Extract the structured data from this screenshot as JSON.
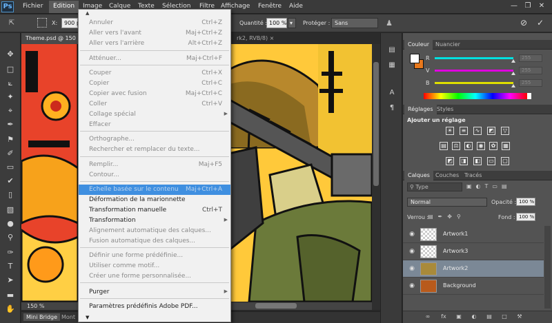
{
  "app": {
    "logo": "Ps"
  },
  "menubar": {
    "items": [
      "Fichier",
      "Edition",
      "Image",
      "Calque",
      "Texte",
      "Sélection",
      "Filtre",
      "Affichage",
      "Fenêtre",
      "Aide"
    ],
    "active_item": "Edition"
  },
  "options_bar": {
    "x_label": "X:",
    "x_value": "900 px",
    "quantity_label": "Quantité :",
    "quantity_value": "100 %",
    "protect_label": "Protéger :",
    "protect_value": "Sans"
  },
  "document": {
    "tab_title": "Theme.psd @ 150",
    "tab2_title": "rk2, RVB/8) ×",
    "zoom": "150 %"
  },
  "bottom_tabs": [
    "Mini Bridge",
    "Mont"
  ],
  "edit_menu": {
    "items": [
      {
        "label": "Annuler",
        "shortcut": "Ctrl+Z",
        "enabled": false
      },
      {
        "label": "Aller vers l'avant",
        "shortcut": "Maj+Ctrl+Z",
        "enabled": false
      },
      {
        "label": "Aller vers l'arrière",
        "shortcut": "Alt+Ctrl+Z",
        "enabled": false
      },
      {
        "label": "Atténuer...",
        "shortcut": "Maj+Ctrl+F",
        "enabled": false
      },
      {
        "label": "Couper",
        "shortcut": "Ctrl+X",
        "enabled": false
      },
      {
        "label": "Copier",
        "shortcut": "Ctrl+C",
        "enabled": false
      },
      {
        "label": "Copier avec fusion",
        "shortcut": "Maj+Ctrl+C",
        "enabled": false
      },
      {
        "label": "Coller",
        "shortcut": "Ctrl+V",
        "enabled": false
      },
      {
        "label": "Collage spécial",
        "shortcut": "",
        "enabled": false,
        "submenu": true
      },
      {
        "label": "Effacer",
        "shortcut": "",
        "enabled": false
      },
      {
        "label": "Orthographe...",
        "shortcut": "",
        "enabled": false
      },
      {
        "label": "Rechercher et remplacer du texte...",
        "shortcut": "",
        "enabled": false
      },
      {
        "label": "Remplir...",
        "shortcut": "Maj+F5",
        "enabled": false
      },
      {
        "label": "Contour...",
        "shortcut": "",
        "enabled": false
      },
      {
        "label": "Echelle basée sur le contenu",
        "shortcut": "Maj+Ctrl+A",
        "enabled": false,
        "highlighted": true
      },
      {
        "label": "Déformation de la marionnette",
        "shortcut": "",
        "enabled": true
      },
      {
        "label": "Transformation manuelle",
        "shortcut": "Ctrl+T",
        "enabled": true
      },
      {
        "label": "Transformation",
        "shortcut": "",
        "enabled": true,
        "submenu": true
      },
      {
        "label": "Alignement automatique des calques...",
        "shortcut": "",
        "enabled": false
      },
      {
        "label": "Fusion automatique des calques...",
        "shortcut": "",
        "enabled": false
      },
      {
        "label": "Définir une forme prédéfinie...",
        "shortcut": "",
        "enabled": false
      },
      {
        "label": "Utiliser comme motif...",
        "shortcut": "",
        "enabled": false
      },
      {
        "label": "Créer une forme personnalisée...",
        "shortcut": "",
        "enabled": false
      },
      {
        "label": "Purger",
        "shortcut": "",
        "enabled": true,
        "submenu": true
      },
      {
        "label": "Paramètres prédéfinis Adobe PDF...",
        "shortcut": "",
        "enabled": true
      }
    ]
  },
  "color_panel": {
    "tabs": [
      "Couleur",
      "Nuancier"
    ],
    "channels": [
      {
        "label": "R",
        "value": "255",
        "color": "#00e0e0"
      },
      {
        "label": "V",
        "value": "255",
        "color": "#e000e0"
      },
      {
        "label": "B",
        "value": "255",
        "color": "#e0e000"
      }
    ]
  },
  "adjust_panel": {
    "tabs": [
      "Réglages",
      "Styles"
    ],
    "title": "Ajouter un réglage"
  },
  "layers_panel": {
    "tabs": [
      "Calques",
      "Couches",
      "Tracés"
    ],
    "filter": "Type",
    "blend_mode": "Normal",
    "opacity_label": "Opacité :",
    "opacity_value": "100 %",
    "lock_label": "Verrou :",
    "fill_label": "Fond :",
    "fill_value": "100 %",
    "layers": [
      {
        "name": "Artwork1",
        "selected": false
      },
      {
        "name": "Artwork3",
        "selected": false
      },
      {
        "name": "Artwork2",
        "selected": true
      },
      {
        "name": "Background",
        "selected": false
      }
    ]
  },
  "colors": {
    "menu_highlight": "#3f8fe0",
    "selected_layer": "#7b8896",
    "foreground": "#ffffff",
    "background_swatch": "#e8781c"
  }
}
